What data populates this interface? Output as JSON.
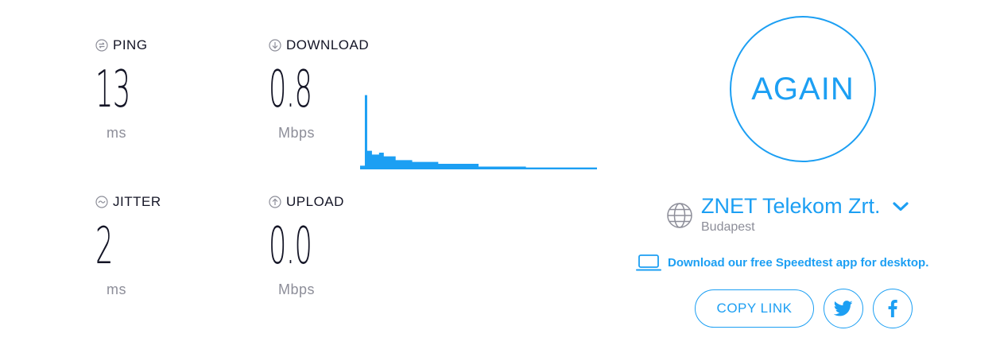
{
  "metrics": {
    "ping": {
      "label": "PING",
      "value": "13",
      "unit": "ms",
      "icon": "ping-icon"
    },
    "download": {
      "label": "DOWNLOAD",
      "value": "0.8",
      "unit": "Mbps",
      "icon": "download-icon"
    },
    "jitter": {
      "label": "JITTER",
      "value": "2",
      "unit": "ms",
      "icon": "jitter-icon"
    },
    "upload": {
      "label": "UPLOAD",
      "value": "0.0",
      "unit": "Mbps",
      "icon": "upload-icon"
    }
  },
  "again_label": "AGAIN",
  "server": {
    "isp": "ZNET Telekom Zrt.",
    "location": "Budapest",
    "icon": "globe-icon"
  },
  "app_link": "Download our free Speedtest app for desktop.",
  "share": {
    "copy_label": "COPY LINK",
    "twitter_icon": "twitter-icon",
    "facebook_icon": "facebook-icon"
  },
  "colors": {
    "accent": "#1c9ff3",
    "text": "#141526",
    "muted": "#8d8e99"
  },
  "chart_data": {
    "type": "area",
    "x": [
      0,
      0.02,
      0.03,
      0.05,
      0.08,
      0.1,
      0.15,
      0.22,
      0.33,
      0.5,
      0.7,
      1.0
    ],
    "values": [
      0.2,
      4.0,
      1.0,
      0.8,
      0.9,
      0.7,
      0.5,
      0.4,
      0.3,
      0.15,
      0.1,
      0.08
    ],
    "series": [
      {
        "values": [
          0.2,
          4.0,
          1.0,
          0.8,
          0.9,
          0.7,
          0.5,
          0.4,
          0.3,
          0.15,
          0.1,
          0.08
        ]
      }
    ],
    "ylim": [
      0,
      4.2
    ],
    "grid": false,
    "color": "#1c9ff3"
  }
}
